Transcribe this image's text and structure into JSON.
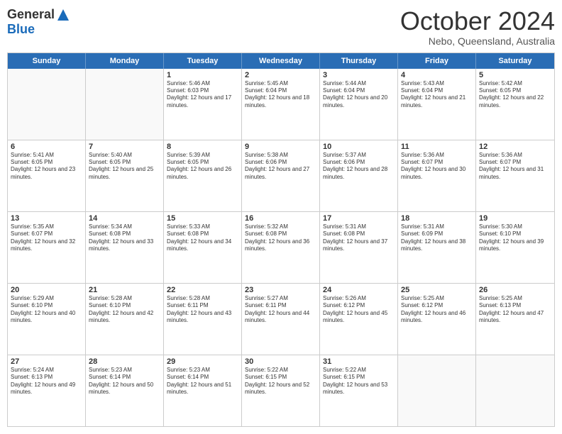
{
  "logo": {
    "general": "General",
    "blue": "Blue"
  },
  "header": {
    "month": "October 2024",
    "location": "Nebo, Queensland, Australia"
  },
  "weekdays": [
    "Sunday",
    "Monday",
    "Tuesday",
    "Wednesday",
    "Thursday",
    "Friday",
    "Saturday"
  ],
  "rows": [
    [
      {
        "day": "",
        "empty": true
      },
      {
        "day": "",
        "empty": true
      },
      {
        "day": "1",
        "sunrise": "5:46 AM",
        "sunset": "6:03 PM",
        "daylight": "12 hours and 17 minutes."
      },
      {
        "day": "2",
        "sunrise": "5:45 AM",
        "sunset": "6:04 PM",
        "daylight": "12 hours and 18 minutes."
      },
      {
        "day": "3",
        "sunrise": "5:44 AM",
        "sunset": "6:04 PM",
        "daylight": "12 hours and 20 minutes."
      },
      {
        "day": "4",
        "sunrise": "5:43 AM",
        "sunset": "6:04 PM",
        "daylight": "12 hours and 21 minutes."
      },
      {
        "day": "5",
        "sunrise": "5:42 AM",
        "sunset": "6:05 PM",
        "daylight": "12 hours and 22 minutes."
      }
    ],
    [
      {
        "day": "6",
        "sunrise": "5:41 AM",
        "sunset": "6:05 PM",
        "daylight": "12 hours and 23 minutes."
      },
      {
        "day": "7",
        "sunrise": "5:40 AM",
        "sunset": "6:05 PM",
        "daylight": "12 hours and 25 minutes."
      },
      {
        "day": "8",
        "sunrise": "5:39 AM",
        "sunset": "6:05 PM",
        "daylight": "12 hours and 26 minutes."
      },
      {
        "day": "9",
        "sunrise": "5:38 AM",
        "sunset": "6:06 PM",
        "daylight": "12 hours and 27 minutes."
      },
      {
        "day": "10",
        "sunrise": "5:37 AM",
        "sunset": "6:06 PM",
        "daylight": "12 hours and 28 minutes."
      },
      {
        "day": "11",
        "sunrise": "5:36 AM",
        "sunset": "6:07 PM",
        "daylight": "12 hours and 30 minutes."
      },
      {
        "day": "12",
        "sunrise": "5:36 AM",
        "sunset": "6:07 PM",
        "daylight": "12 hours and 31 minutes."
      }
    ],
    [
      {
        "day": "13",
        "sunrise": "5:35 AM",
        "sunset": "6:07 PM",
        "daylight": "12 hours and 32 minutes."
      },
      {
        "day": "14",
        "sunrise": "5:34 AM",
        "sunset": "6:08 PM",
        "daylight": "12 hours and 33 minutes."
      },
      {
        "day": "15",
        "sunrise": "5:33 AM",
        "sunset": "6:08 PM",
        "daylight": "12 hours and 34 minutes."
      },
      {
        "day": "16",
        "sunrise": "5:32 AM",
        "sunset": "6:08 PM",
        "daylight": "12 hours and 36 minutes."
      },
      {
        "day": "17",
        "sunrise": "5:31 AM",
        "sunset": "6:08 PM",
        "daylight": "12 hours and 37 minutes."
      },
      {
        "day": "18",
        "sunrise": "5:31 AM",
        "sunset": "6:09 PM",
        "daylight": "12 hours and 38 minutes."
      },
      {
        "day": "19",
        "sunrise": "5:30 AM",
        "sunset": "6:10 PM",
        "daylight": "12 hours and 39 minutes."
      }
    ],
    [
      {
        "day": "20",
        "sunrise": "5:29 AM",
        "sunset": "6:10 PM",
        "daylight": "12 hours and 40 minutes."
      },
      {
        "day": "21",
        "sunrise": "5:28 AM",
        "sunset": "6:10 PM",
        "daylight": "12 hours and 42 minutes."
      },
      {
        "day": "22",
        "sunrise": "5:28 AM",
        "sunset": "6:11 PM",
        "daylight": "12 hours and 43 minutes."
      },
      {
        "day": "23",
        "sunrise": "5:27 AM",
        "sunset": "6:11 PM",
        "daylight": "12 hours and 44 minutes."
      },
      {
        "day": "24",
        "sunrise": "5:26 AM",
        "sunset": "6:12 PM",
        "daylight": "12 hours and 45 minutes."
      },
      {
        "day": "25",
        "sunrise": "5:25 AM",
        "sunset": "6:12 PM",
        "daylight": "12 hours and 46 minutes."
      },
      {
        "day": "26",
        "sunrise": "5:25 AM",
        "sunset": "6:13 PM",
        "daylight": "12 hours and 47 minutes."
      }
    ],
    [
      {
        "day": "27",
        "sunrise": "5:24 AM",
        "sunset": "6:13 PM",
        "daylight": "12 hours and 49 minutes."
      },
      {
        "day": "28",
        "sunrise": "5:23 AM",
        "sunset": "6:14 PM",
        "daylight": "12 hours and 50 minutes."
      },
      {
        "day": "29",
        "sunrise": "5:23 AM",
        "sunset": "6:14 PM",
        "daylight": "12 hours and 51 minutes."
      },
      {
        "day": "30",
        "sunrise": "5:22 AM",
        "sunset": "6:15 PM",
        "daylight": "12 hours and 52 minutes."
      },
      {
        "day": "31",
        "sunrise": "5:22 AM",
        "sunset": "6:15 PM",
        "daylight": "12 hours and 53 minutes."
      },
      {
        "day": "",
        "empty": true
      },
      {
        "day": "",
        "empty": true
      }
    ]
  ]
}
